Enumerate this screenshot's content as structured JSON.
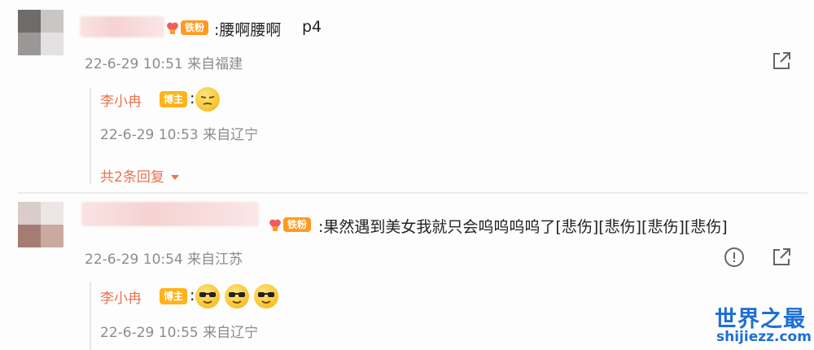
{
  "comments": [
    {
      "badge": "铁粉",
      "text": ":腰啊腰啊",
      "suffix": "p4",
      "meta": "22-6-29 10:51 来自福建",
      "reply": {
        "name": "李小冉",
        "host_badge": "博主",
        "emoji": [
          "smug-emoji"
        ],
        "meta": "22-6-29 10:53 来自辽宁"
      },
      "more_replies": "共2条回复"
    },
    {
      "badge": "铁粉",
      "text": ":果然遇到美女我就只会呜呜呜呜了[悲伤][悲伤][悲伤][悲伤]",
      "meta": "22-6-29 10:54 来自江苏",
      "reply": {
        "name": "李小冉",
        "host_badge": "博主",
        "emoji": [
          "sunglasses-emoji",
          "sunglasses-emoji",
          "sunglasses-emoji"
        ],
        "meta": "22-6-29 10:55 来自辽宁"
      }
    }
  ],
  "watermark": {
    "title": "世界之最",
    "url": "shijiezz.com"
  },
  "colors": {
    "accent": "#eb7350",
    "fan_badge": "#ff9a1f",
    "host_badge": "#ffb21a",
    "meta": "#8c8c8c",
    "watermark": "#1d6fd4"
  }
}
